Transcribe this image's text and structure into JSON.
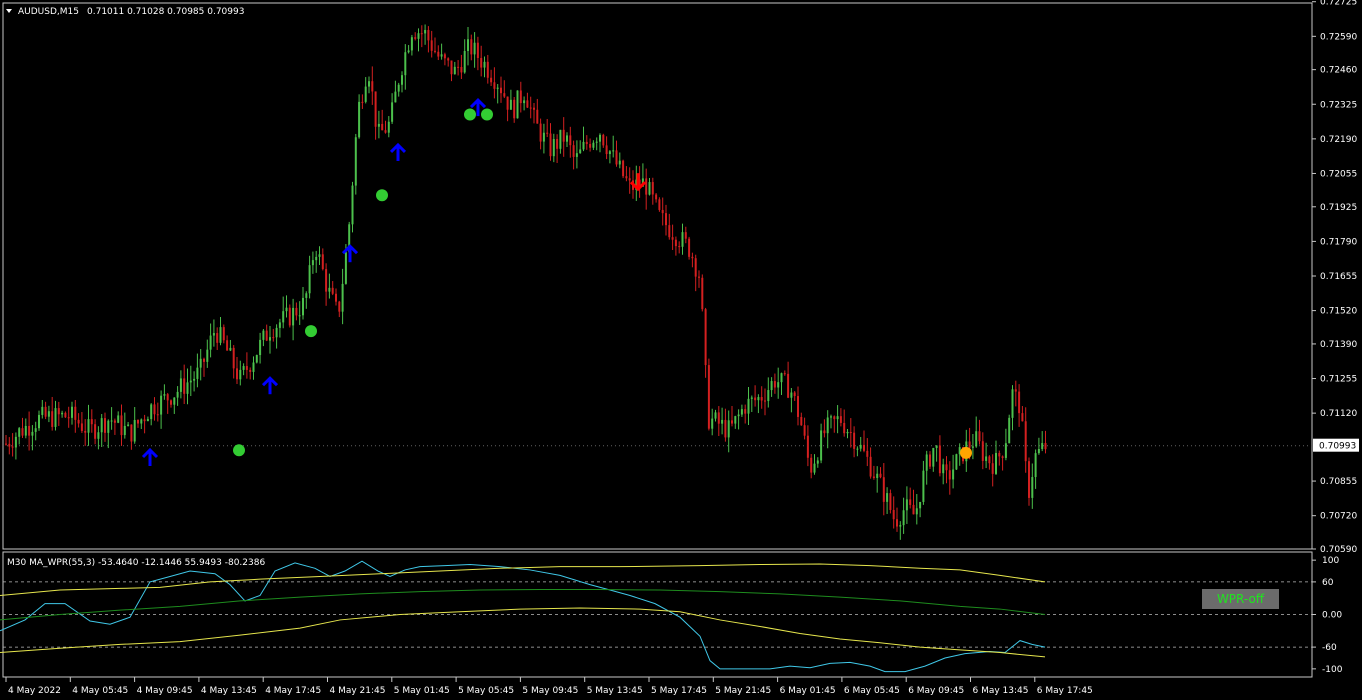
{
  "header": {
    "symbol": "AUDUSD,M15",
    "ohlc": "0.71011 0.71028 0.70985 0.70993"
  },
  "current_price": "0.70993",
  "indicator": {
    "title": "M30 MA_WPR(55,3) -53.4640 -12.1446 55.9493 -80.2386",
    "button_label": "WPR-off"
  },
  "colors": {
    "background": "#000000",
    "bull_candle": "#4cc04c",
    "bear_candle": "#d42020",
    "up_arrow": "#0000ff",
    "down_arrow": "#ff0000",
    "signal_dot": "#33cc33",
    "signal_dot_alt": "#ffa500",
    "wpr_line": "#40c8e8",
    "band_line": "#e6e64d",
    "mid_line": "#1e8c1e"
  },
  "chart_data": [
    {
      "type": "candlestick",
      "ylim": [
        0.7059,
        0.7272
      ],
      "y_ticks": [
        "0.72725",
        "0.72590",
        "0.72460",
        "0.72325",
        "0.72190",
        "0.72055",
        "0.71925",
        "0.71790",
        "0.71655",
        "0.71520",
        "0.71390",
        "0.71255",
        "0.71120",
        "0.70855",
        "0.70720",
        "0.70590"
      ],
      "x_ticks": [
        "4 May 2022",
        "4 May 05:45",
        "4 May 09:45",
        "4 May 13:45",
        "4 May 17:45",
        "4 May 21:45",
        "5 May 01:45",
        "5 May 05:45",
        "5 May 09:45",
        "5 May 13:45",
        "5 May 17:45",
        "5 May 21:45",
        "6 May 01:45",
        "6 May 05:45",
        "6 May 09:45",
        "6 May 13:45",
        "6 May 17:45"
      ],
      "price_path": [
        [
          0,
          0.7098
        ],
        [
          20,
          0.7105
        ],
        [
          40,
          0.711
        ],
        [
          70,
          0.7111
        ],
        [
          90,
          0.7105
        ],
        [
          110,
          0.711
        ],
        [
          130,
          0.7104
        ],
        [
          150,
          0.7114
        ],
        [
          175,
          0.712
        ],
        [
          200,
          0.7128
        ],
        [
          215,
          0.7145
        ],
        [
          225,
          0.7138
        ],
        [
          240,
          0.7125
        ],
        [
          255,
          0.7135
        ],
        [
          270,
          0.7145
        ],
        [
          290,
          0.715
        ],
        [
          305,
          0.7155
        ],
        [
          315,
          0.7178
        ],
        [
          328,
          0.716
        ],
        [
          338,
          0.715
        ],
        [
          348,
          0.718
        ],
        [
          358,
          0.723
        ],
        [
          368,
          0.7248
        ],
        [
          378,
          0.722
        ],
        [
          390,
          0.7225
        ],
        [
          400,
          0.7245
        ],
        [
          412,
          0.7262
        ],
        [
          425,
          0.726
        ],
        [
          440,
          0.725
        ],
        [
          455,
          0.7245
        ],
        [
          470,
          0.7255
        ],
        [
          485,
          0.7248
        ],
        [
          500,
          0.724
        ],
        [
          512,
          0.723
        ],
        [
          525,
          0.7238
        ],
        [
          535,
          0.7225
        ],
        [
          550,
          0.7215
        ],
        [
          565,
          0.722
        ],
        [
          575,
          0.721
        ],
        [
          588,
          0.7218
        ],
        [
          600,
          0.7222
        ],
        [
          615,
          0.721
        ],
        [
          630,
          0.72
        ],
        [
          645,
          0.7202
        ],
        [
          660,
          0.7188
        ],
        [
          675,
          0.7182
        ],
        [
          690,
          0.7176
        ],
        [
          700,
          0.7165
        ],
        [
          708,
          0.711
        ],
        [
          718,
          0.7108
        ],
        [
          730,
          0.7105
        ],
        [
          745,
          0.7115
        ],
        [
          760,
          0.7118
        ],
        [
          775,
          0.7125
        ],
        [
          790,
          0.7122
        ],
        [
          800,
          0.711
        ],
        [
          810,
          0.709
        ],
        [
          825,
          0.7105
        ],
        [
          840,
          0.711
        ],
        [
          855,
          0.7102
        ],
        [
          870,
          0.7092
        ],
        [
          885,
          0.708
        ],
        [
          895,
          0.707
        ],
        [
          905,
          0.7075
        ],
        [
          915,
          0.7072
        ],
        [
          925,
          0.709
        ],
        [
          935,
          0.71
        ],
        [
          945,
          0.7085
        ],
        [
          955,
          0.7092
        ],
        [
          965,
          0.7098
        ],
        [
          975,
          0.7102
        ],
        [
          985,
          0.7095
        ],
        [
          995,
          0.7092
        ],
        [
          1005,
          0.71
        ],
        [
          1012,
          0.712
        ],
        [
          1020,
          0.7115
        ],
        [
          1028,
          0.708
        ],
        [
          1035,
          0.7095
        ],
        [
          1045,
          0.7099
        ]
      ],
      "signals": [
        {
          "kind": "up-arrow",
          "x": 150,
          "price": 0.70945
        },
        {
          "kind": "up-arrow",
          "x": 270,
          "price": 0.71225
        },
        {
          "kind": "up-arrow",
          "x": 350,
          "price": 0.7174
        },
        {
          "kind": "up-arrow",
          "x": 398,
          "price": 0.72135
        },
        {
          "kind": "up-arrow",
          "x": 478,
          "price": 0.7231
        },
        {
          "kind": "down-arrow",
          "x": 638,
          "price": 0.72025
        },
        {
          "kind": "dot",
          "x": 239,
          "price": 0.70975
        },
        {
          "kind": "dot",
          "x": 311,
          "price": 0.7144
        },
        {
          "kind": "dot",
          "x": 382,
          "price": 0.7197
        },
        {
          "kind": "dot",
          "x": 470,
          "price": 0.72285
        },
        {
          "kind": "dot",
          "x": 487,
          "price": 0.72285
        },
        {
          "kind": "dot-alt",
          "x": 966,
          "price": 0.70965
        }
      ]
    },
    {
      "type": "line",
      "ylim": [
        -115,
        115
      ],
      "y_ticks": [
        "100",
        "60",
        "0.00",
        "-60",
        "-100"
      ],
      "levels": [
        60,
        0,
        -60
      ],
      "series": [
        {
          "role": "wpr",
          "points": [
            [
              0,
              -30
            ],
            [
              25,
              -10
            ],
            [
              45,
              20
            ],
            [
              65,
              20
            ],
            [
              90,
              -12
            ],
            [
              110,
              -18
            ],
            [
              130,
              -5
            ],
            [
              150,
              60
            ],
            [
              170,
              70
            ],
            [
              190,
              80
            ],
            [
              215,
              75
            ],
            [
              230,
              55
            ],
            [
              245,
              25
            ],
            [
              260,
              35
            ],
            [
              275,
              80
            ],
            [
              295,
              95
            ],
            [
              315,
              85
            ],
            [
              330,
              70
            ],
            [
              345,
              80
            ],
            [
              362,
              98
            ],
            [
              378,
              80
            ],
            [
              390,
              70
            ],
            [
              405,
              82
            ],
            [
              420,
              88
            ],
            [
              445,
              90
            ],
            [
              470,
              92
            ],
            [
              500,
              88
            ],
            [
              530,
              82
            ],
            [
              560,
              72
            ],
            [
              590,
              55
            ],
            [
              610,
              45
            ],
            [
              630,
              35
            ],
            [
              655,
              20
            ],
            [
              680,
              -5
            ],
            [
              700,
              -40
            ],
            [
              710,
              -85
            ],
            [
              720,
              -100
            ],
            [
              740,
              -100
            ],
            [
              770,
              -100
            ],
            [
              790,
              -95
            ],
            [
              810,
              -98
            ],
            [
              830,
              -90
            ],
            [
              850,
              -88
            ],
            [
              870,
              -95
            ],
            [
              885,
              -105
            ],
            [
              905,
              -105
            ],
            [
              925,
              -95
            ],
            [
              945,
              -80
            ],
            [
              965,
              -72
            ],
            [
              990,
              -68
            ],
            [
              1005,
              -70
            ],
            [
              1020,
              -48
            ],
            [
              1032,
              -55
            ],
            [
              1045,
              -60
            ]
          ]
        },
        {
          "role": "upper-band",
          "points": [
            [
              0,
              35
            ],
            [
              60,
              45
            ],
            [
              120,
              48
            ],
            [
              160,
              50
            ],
            [
              210,
              60
            ],
            [
              260,
              65
            ],
            [
              320,
              70
            ],
            [
              380,
              75
            ],
            [
              440,
              80
            ],
            [
              500,
              85
            ],
            [
              560,
              88
            ],
            [
              620,
              88
            ],
            [
              700,
              90
            ],
            [
              760,
              92
            ],
            [
              820,
              93
            ],
            [
              870,
              90
            ],
            [
              920,
              85
            ],
            [
              960,
              82
            ],
            [
              1000,
              72
            ],
            [
              1045,
              60
            ]
          ]
        },
        {
          "role": "mid-line",
          "points": [
            [
              0,
              -10
            ],
            [
              60,
              0
            ],
            [
              120,
              8
            ],
            [
              180,
              15
            ],
            [
              240,
              25
            ],
            [
              300,
              32
            ],
            [
              360,
              38
            ],
            [
              420,
              42
            ],
            [
              480,
              45
            ],
            [
              540,
              46
            ],
            [
              600,
              46
            ],
            [
              660,
              45
            ],
            [
              720,
              42
            ],
            [
              780,
              38
            ],
            [
              840,
              32
            ],
            [
              900,
              25
            ],
            [
              960,
              15
            ],
            [
              1000,
              10
            ],
            [
              1045,
              0
            ]
          ]
        },
        {
          "role": "lower-band",
          "points": [
            [
              0,
              -70
            ],
            [
              60,
              -62
            ],
            [
              120,
              -55
            ],
            [
              180,
              -50
            ],
            [
              240,
              -38
            ],
            [
              300,
              -25
            ],
            [
              340,
              -10
            ],
            [
              400,
              0
            ],
            [
              460,
              5
            ],
            [
              520,
              10
            ],
            [
              580,
              12
            ],
            [
              640,
              10
            ],
            [
              680,
              5
            ],
            [
              720,
              -10
            ],
            [
              760,
              -22
            ],
            [
              800,
              -35
            ],
            [
              840,
              -45
            ],
            [
              880,
              -52
            ],
            [
              920,
              -60
            ],
            [
              960,
              -65
            ],
            [
              1000,
              -70
            ],
            [
              1045,
              -78
            ]
          ]
        }
      ]
    }
  ]
}
